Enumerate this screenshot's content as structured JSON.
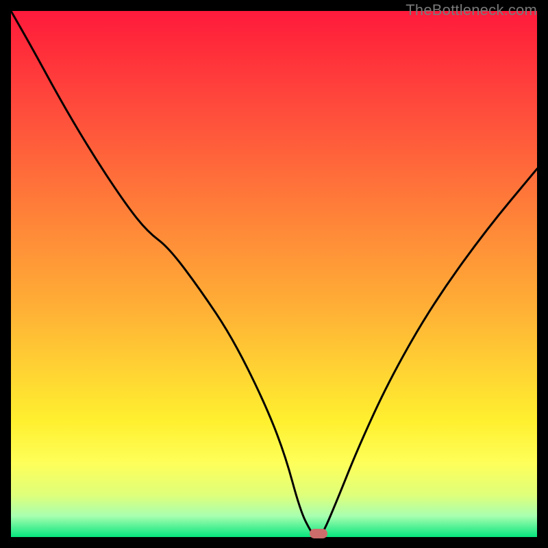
{
  "watermark": "TheBottleneck.com",
  "colors": {
    "gradient_top": "#ff1a3c",
    "gradient_bottom": "#06e57d",
    "marker": "#cc6d6b",
    "curve": "#000000"
  },
  "chart_data": {
    "type": "line",
    "title": "",
    "xlabel": "",
    "ylabel": "",
    "xlim": [
      0,
      100
    ],
    "ylim": [
      0,
      100
    ],
    "grid": false,
    "series": [
      {
        "name": "curve",
        "x": [
          0,
          4,
          10,
          16,
          22,
          26,
          30,
          36,
          42,
          48,
          52,
          55,
          57,
          58,
          59,
          62,
          66,
          72,
          80,
          90,
          100
        ],
        "values": [
          100,
          93,
          82,
          72,
          63,
          58,
          55,
          47,
          38,
          26,
          16,
          5,
          1,
          0,
          0,
          7,
          17,
          30,
          44,
          58,
          70
        ]
      }
    ],
    "marker": {
      "x": 58.5,
      "y": 0.5
    },
    "annotations": []
  }
}
